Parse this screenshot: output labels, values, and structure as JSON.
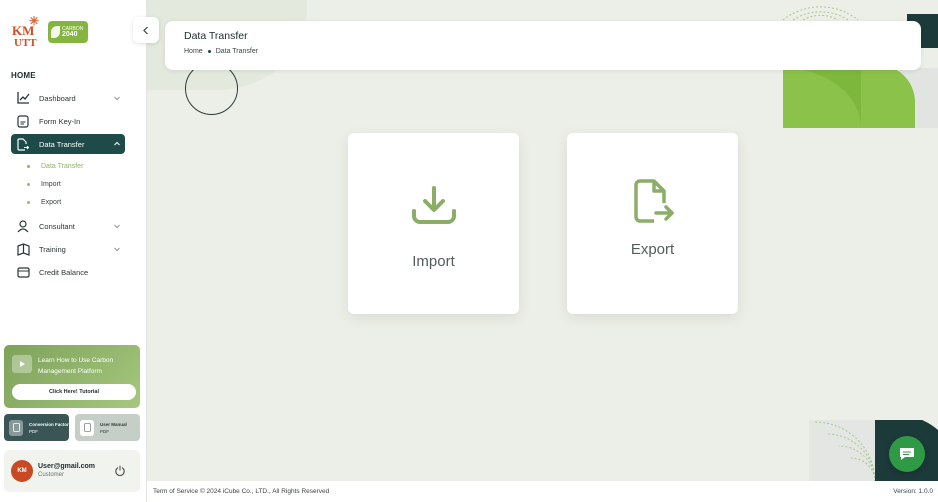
{
  "brand": {
    "logo_text_top": "KM",
    "logo_text_bottom": "UTT",
    "badge_top": "CARBON",
    "badge_year": "2040"
  },
  "sidebar": {
    "section_label": "HOME",
    "items": [
      {
        "label": "Dashboard",
        "icon": "chart-line-icon",
        "has_children": true
      },
      {
        "label": "Form Key-In",
        "icon": "form-icon",
        "has_children": false
      },
      {
        "label": "Data Transfer",
        "icon": "file-transfer-icon",
        "has_children": true,
        "active": true,
        "children": [
          {
            "label": "Data Transfer",
            "current": true
          },
          {
            "label": "Import",
            "current": false
          },
          {
            "label": "Export",
            "current": false
          }
        ]
      },
      {
        "label": "Consultant",
        "icon": "person-icon",
        "has_children": true
      },
      {
        "label": "Training",
        "icon": "book-icon",
        "has_children": true
      },
      {
        "label": "Credit Balance",
        "icon": "wallet-icon",
        "has_children": false
      }
    ],
    "tutorial": {
      "text": "Learn How to Use Carbon Management Platform",
      "button": "Click Here! Tutorial"
    },
    "docs": [
      {
        "title": "Conversion Factor",
        "type": "PDF"
      },
      {
        "title": "User Manual",
        "type": "PDF"
      }
    ],
    "user": {
      "email": "User@gmail.com",
      "role": "Customer"
    }
  },
  "header": {
    "title": "Data Transfer",
    "breadcrumb": [
      "Home",
      "Data Transfer"
    ]
  },
  "actions": {
    "import_label": "Import",
    "export_label": "Export"
  },
  "footer": {
    "left": "Term of Service © 2024 iCube Co., LTD., All Rights Reserved",
    "right": "Version: 1.0.0"
  },
  "colors": {
    "primary_dark": "#1e4a4a",
    "accent_green": "#8fb36a",
    "chat_green": "#2f9a46",
    "bg": "#ecefe7"
  }
}
